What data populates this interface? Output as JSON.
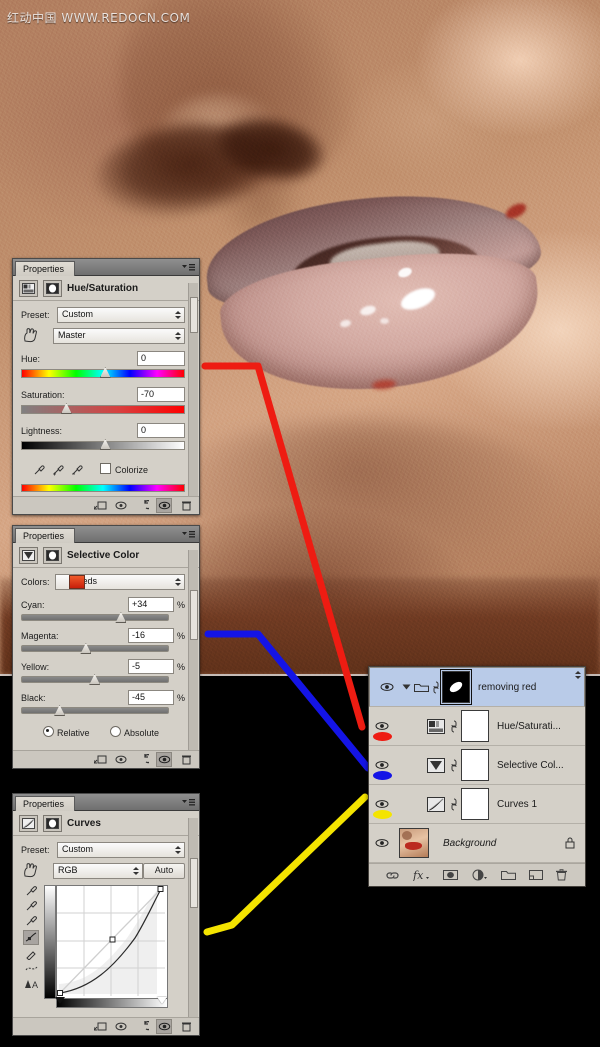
{
  "watermark": "红动中国 WWW.REDOCN.COM",
  "colors": {
    "accent_red": "#ee1c12",
    "accent_blue": "#1414e6",
    "accent_yellow": "#f4e400",
    "panel_bg": "#d4d0c8",
    "layer_selected": "#b9cbe8",
    "reds_swatch": "#e03418"
  },
  "hue_saturation_panel": {
    "tab_label": "Properties",
    "title": "Hue/Saturation",
    "preset_label": "Preset:",
    "preset_value": "Custom",
    "channel_value": "Master",
    "hue_label": "Hue:",
    "hue_value": "0",
    "saturation_label": "Saturation:",
    "saturation_value": "-70",
    "lightness_label": "Lightness:",
    "lightness_value": "0",
    "colorize_label": "Colorize"
  },
  "selective_color_panel": {
    "tab_label": "Properties",
    "title": "Selective Color",
    "colors_label": "Colors:",
    "colors_value": "Reds",
    "cyan_label": "Cyan:",
    "cyan_value": "+34",
    "magenta_label": "Magenta:",
    "magenta_value": "-16",
    "yellow_label": "Yellow:",
    "yellow_value": "-5",
    "black_label": "Black:",
    "black_value": "-45",
    "percent": "%",
    "relative_label": "Relative",
    "absolute_label": "Absolute"
  },
  "curves_panel": {
    "tab_label": "Properties",
    "title": "Curves",
    "preset_label": "Preset:",
    "preset_value": "Custom",
    "channel_value": "RGB",
    "auto_label": "Auto"
  },
  "layers_panel": {
    "rows": [
      {
        "name": "removing red",
        "selected": true,
        "kind": "group",
        "dot": "none",
        "locked": false
      },
      {
        "name": "Hue/Saturati...",
        "selected": false,
        "kind": "hue-saturation",
        "dot": "red",
        "locked": false
      },
      {
        "name": "Selective Col...",
        "selected": false,
        "kind": "selective-color",
        "dot": "blue",
        "locked": false
      },
      {
        "name": "Curves 1",
        "selected": false,
        "kind": "curves",
        "dot": "yellow",
        "locked": false
      },
      {
        "name": "Background",
        "selected": false,
        "kind": "background",
        "dot": "none",
        "locked": true
      }
    ],
    "footer_icons": [
      "link-icon",
      "fx-icon",
      "add-mask-icon",
      "adjustment-icon",
      "new-group-icon",
      "new-layer-icon",
      "delete-layer-icon"
    ]
  },
  "panel_footer_icons": [
    "clip-to-layer-icon",
    "view-previous-state-icon",
    "reset-icon",
    "toggle-visibility-icon",
    "delete-adjustment-icon"
  ]
}
